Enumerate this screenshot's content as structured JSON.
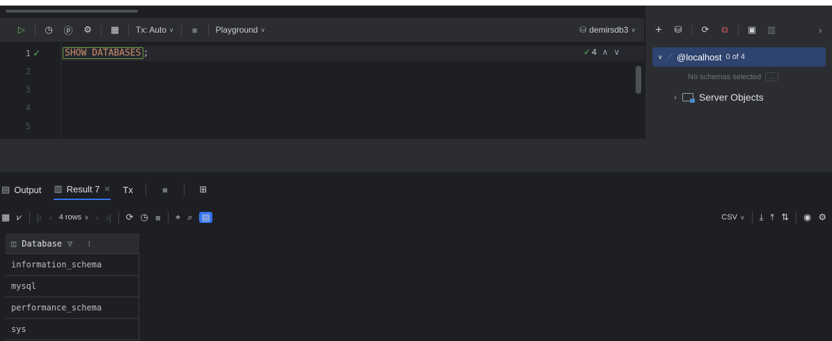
{
  "editor_toolbar": {
    "tx_label": "Tx: Auto",
    "playground_label": "Playground",
    "datasource_label": "demirsdb3"
  },
  "editor": {
    "line_numbers": [
      "1",
      "2",
      "3",
      "4",
      "5"
    ],
    "code_keyword": "SHOW DATABASES",
    "code_punct": ";",
    "inspection_count": "4"
  },
  "database_panel": {
    "host_label": "@localhost",
    "host_count": "0 of 4",
    "no_schemas_text": "No schemas selected",
    "no_schemas_button": "...",
    "server_objects_label": "Server Objects"
  },
  "bottom_tabs": {
    "output_label": "Output",
    "result_label": "Result 7",
    "tx_label": "Tx"
  },
  "results_toolbar": {
    "rows_label": "4 rows",
    "export_format": "CSV"
  },
  "result_grid": {
    "column_header": "Database",
    "rows": [
      "information_schema",
      "mysql",
      "performance_schema",
      "sys"
    ]
  },
  "colors": {
    "background": "#1e1f22",
    "panel": "#2b2d30",
    "accent": "#3574f0",
    "success": "#5fb865",
    "keyword": "#cf8e6d"
  }
}
